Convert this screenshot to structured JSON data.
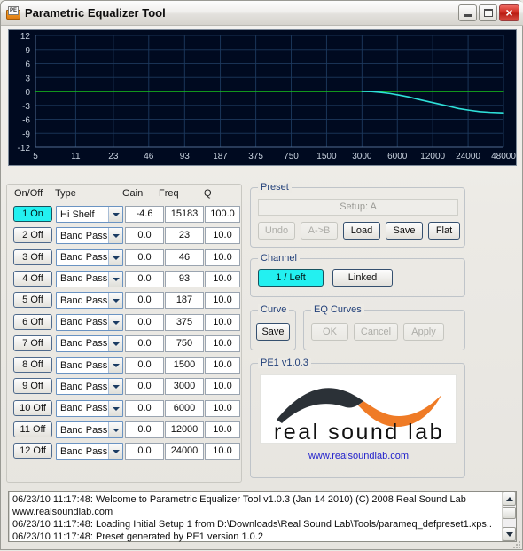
{
  "window": {
    "title": "Parametric Equalizer Tool",
    "icon": "app-icon",
    "minimize_label": "",
    "maximize_label": "",
    "close_label": "×"
  },
  "chart_data": {
    "type": "line",
    "title": "",
    "xlabel": "",
    "ylabel": "",
    "xtick_labels": [
      "5",
      "11",
      "23",
      "46",
      "93",
      "187",
      "375",
      "750",
      "1500",
      "3000",
      "6000",
      "12000",
      "24000",
      "48000"
    ],
    "ytick_labels": [
      "12",
      "9",
      "6",
      "3",
      "0",
      "-3",
      "-6",
      "-9",
      "-12"
    ],
    "ylim": [
      -12,
      12
    ],
    "xlim_log_hz": [
      5,
      48000
    ],
    "grid": true,
    "background_color": "#000a20",
    "grid_color": "#1d3a5e",
    "series": [
      {
        "name": "zero-reference",
        "color": "#17c41c",
        "x": [
          5,
          48000
        ],
        "y": [
          0,
          0
        ]
      },
      {
        "name": "eq-response",
        "color": "#2ee0d8",
        "x": [
          3000,
          3600,
          4300,
          5200,
          6200,
          7500,
          9000,
          11000,
          13500,
          16500,
          20000,
          24500,
          30000,
          37000,
          45000,
          48000
        ],
        "y": [
          0.0,
          -0.05,
          -0.2,
          -0.45,
          -0.8,
          -1.2,
          -1.7,
          -2.2,
          -2.7,
          -3.2,
          -3.7,
          -4.05,
          -4.35,
          -4.5,
          -4.58,
          -4.6
        ]
      }
    ]
  },
  "filter_table": {
    "headers": [
      "On/Off",
      "Type",
      "Gain",
      "Freq",
      "Q"
    ],
    "rows": [
      {
        "onoff": "1 On",
        "on": true,
        "type": "Hi Shelf",
        "gain": "-4.6",
        "freq": "15183",
        "q": "100.0"
      },
      {
        "onoff": "2 Off",
        "on": false,
        "type": "Band Pass",
        "gain": "0.0",
        "freq": "23",
        "q": "10.0"
      },
      {
        "onoff": "3 Off",
        "on": false,
        "type": "Band Pass",
        "gain": "0.0",
        "freq": "46",
        "q": "10.0"
      },
      {
        "onoff": "4 Off",
        "on": false,
        "type": "Band Pass",
        "gain": "0.0",
        "freq": "93",
        "q": "10.0"
      },
      {
        "onoff": "5 Off",
        "on": false,
        "type": "Band Pass",
        "gain": "0.0",
        "freq": "187",
        "q": "10.0"
      },
      {
        "onoff": "6 Off",
        "on": false,
        "type": "Band Pass",
        "gain": "0.0",
        "freq": "375",
        "q": "10.0"
      },
      {
        "onoff": "7 Off",
        "on": false,
        "type": "Band Pass",
        "gain": "0.0",
        "freq": "750",
        "q": "10.0"
      },
      {
        "onoff": "8 Off",
        "on": false,
        "type": "Band Pass",
        "gain": "0.0",
        "freq": "1500",
        "q": "10.0"
      },
      {
        "onoff": "9 Off",
        "on": false,
        "type": "Band Pass",
        "gain": "0.0",
        "freq": "3000",
        "q": "10.0"
      },
      {
        "onoff": "10 Off",
        "on": false,
        "type": "Band Pass",
        "gain": "0.0",
        "freq": "6000",
        "q": "10.0"
      },
      {
        "onoff": "11 Off",
        "on": false,
        "type": "Band Pass",
        "gain": "0.0",
        "freq": "12000",
        "q": "10.0"
      },
      {
        "onoff": "12 Off",
        "on": false,
        "type": "Band Pass",
        "gain": "0.0",
        "freq": "24000",
        "q": "10.0"
      }
    ]
  },
  "preset": {
    "group_label": "Preset",
    "field_value": "Setup: A",
    "undo_label": "Undo",
    "ab_label": "A->B",
    "load_label": "Load",
    "save_label": "Save",
    "flat_label": "Flat"
  },
  "channel": {
    "group_label": "Channel",
    "selected_label": "1 / Left",
    "linked_label": "Linked"
  },
  "curve": {
    "group_label": "Curve",
    "save_label": "Save"
  },
  "eq_curves": {
    "group_label": "EQ Curves",
    "ok_label": "OK",
    "cancel_label": "Cancel",
    "apply_label": "Apply"
  },
  "brand": {
    "group_label": "PE1 v1.0.3",
    "logo_text": "real sound lab",
    "logo_dark_color": "#2b3137",
    "logo_orange_color": "#ef7b26",
    "link_text": "www.realsoundlab.com"
  },
  "log": {
    "lines": [
      "06/23/10 11:17:48: Welcome to Parametric Equalizer Tool v1.0.3 (Jan 14 2010) (C) 2008 Real Sound Lab",
      "www.realsoundlab.com",
      "06/23/10 11:17:48: Loading Initial Setup 1 from D:\\Downloads\\Real Sound Lab\\Tools/parameq_defpreset1.xps...",
      "06/23/10 11:17:48: Preset generated by PE1 version 1.0.2"
    ]
  }
}
